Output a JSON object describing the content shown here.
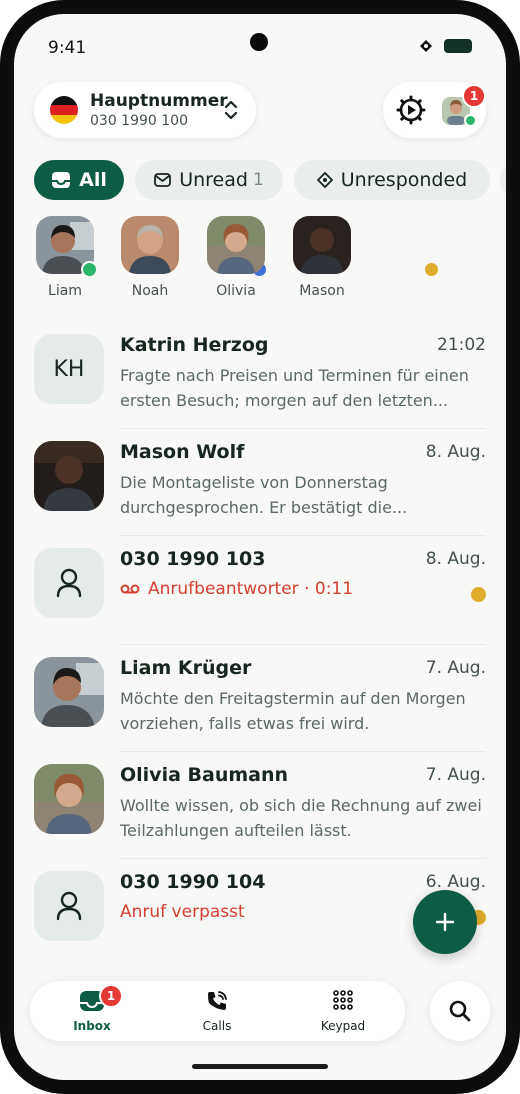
{
  "status_bar": {
    "time": "9:41"
  },
  "header": {
    "number_name": "Hauptnummer",
    "number_value": "030 1990 100",
    "profile_badge": "1"
  },
  "filters": {
    "all": "All",
    "unread": "Unread",
    "unread_count": "1",
    "unresponded": "Unresponded"
  },
  "stories": [
    {
      "name": "Liam",
      "status_color": "#2db46b"
    },
    {
      "name": "Noah",
      "status_color": "#3e6fd8"
    },
    {
      "name": "Olivia",
      "status_color": "#e0ac2c"
    },
    {
      "name": "Mason",
      "status_color": "#b9c0bc"
    }
  ],
  "conversations": [
    {
      "name": "Katrin Herzog",
      "initials": "KH",
      "time": "21:02",
      "preview": "Fragte nach Preisen und Terminen für einen ersten Besuch; morgen auf den letzten..."
    },
    {
      "name": "Mason Wolf",
      "time": "8. Aug.",
      "preview": "Die Montageliste von Donnerstag durchgesprochen. Er bestätigt die..."
    },
    {
      "name": "030 1990 103",
      "time": "8. Aug.",
      "alert": "Anrufbeantworter · 0:11",
      "unread": true
    },
    {
      "name": "Liam Krüger",
      "time": "7. Aug.",
      "preview": "Möchte den Freitagstermin auf den Morgen vorziehen, falls etwas frei wird."
    },
    {
      "name": "Olivia Baumann",
      "time": "7. Aug.",
      "preview": "Wollte wissen, ob sich die Rechnung auf zwei Teilzahlungen aufteilen lässt."
    },
    {
      "name": "030 1990 104",
      "time": "6. Aug.",
      "alert": "Anruf verpasst",
      "unread": true
    }
  ],
  "bottom_nav": {
    "inbox": "Inbox",
    "inbox_badge": "1",
    "calls": "Calls",
    "keypad": "Keypad"
  },
  "colors": {
    "brand": "#0d5c45",
    "alert": "#d3402f",
    "unread": "#e0ac2c",
    "badge": "#e53935"
  },
  "icons": [
    "gear-icon",
    "chevron-updown-icon",
    "inbox-icon",
    "mail-icon",
    "diamond-icon",
    "person-icon",
    "voicemail-icon",
    "plus-icon",
    "phone-icon",
    "keypad-icon",
    "search-icon"
  ]
}
